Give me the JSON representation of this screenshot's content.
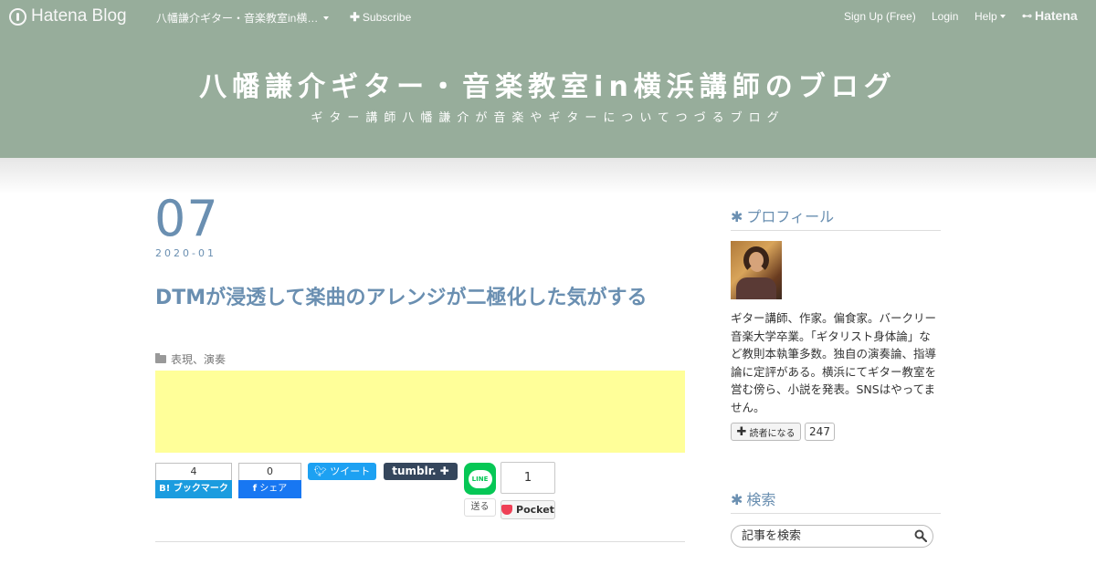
{
  "topbar": {
    "brand": "Hatena Blog",
    "blog_name": "八幡謙介ギター・音楽教室in横…",
    "subscribe": "Subscribe",
    "signup": "Sign Up (Free)",
    "login": "Login",
    "help": "Help",
    "hatena_logo": "Hatena"
  },
  "header": {
    "title": "八幡謙介ギター・音楽教室in横浜講師のブログ",
    "description": "ギター講師八幡謙介が音楽やギターについてつづるブログ",
    "color": "#97ad9b"
  },
  "entry": {
    "day": "07",
    "year_month": "2020-01",
    "title": "DTMが浸透して楽曲のアレンジが二極化した気がする",
    "categories": "表現、演奏",
    "accent_color": "#6a8fb1",
    "ad_color": "#ffff99"
  },
  "share": {
    "hatena_count": "4",
    "hatena_label": "B! ブックマーク",
    "facebook_count": "0",
    "facebook_label": "シェア",
    "tweet_label": "ツイート",
    "tumblr_label": "tumblr. ✚",
    "line_label": "LINE",
    "line_send": "送る",
    "pocket_count": "1",
    "pocket_label": "Pocket"
  },
  "sidebar": {
    "profile_heading": "プロフィール",
    "bio": "ギター講師、作家。偏食家。バークリー音楽大学卒業。「ギタリスト身体論」など教則本執筆多数。独自の演奏論、指導論に定評がある。横浜にてギター教室を営む傍ら、小説を発表。SNSはやってません。",
    "reader_label": "読者になる",
    "reader_count": "247",
    "search_heading": "検索",
    "search_placeholder": "記事を検索"
  }
}
